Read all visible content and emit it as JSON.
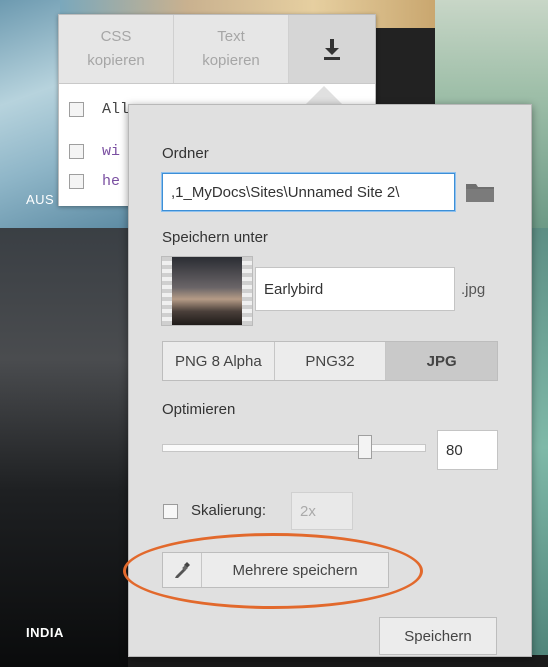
{
  "background": {
    "caption_top": "AUS",
    "caption_bottom": "INDIA"
  },
  "copy_popover": {
    "css_copy_label": "CSS kopieren",
    "css_copy_line1": "CSS",
    "css_copy_line2": "kopieren",
    "text_copy_line1": "Text",
    "text_copy_line2": "kopieren",
    "download_icon": "download-icon",
    "rows": [
      {
        "text": "All"
      },
      {
        "text": "wi"
      },
      {
        "text": "he"
      }
    ]
  },
  "dialog": {
    "folder_label": "Ordner",
    "folder_value": ",1_MyDocs\\Sites\\Unnamed Site 2\\",
    "folder_icon": "folder-icon",
    "save_as_label": "Speichern unter",
    "filename_value": "Earlybird",
    "extension": ".jpg",
    "formats": [
      {
        "label": "PNG 8 Alpha",
        "active": false
      },
      {
        "label": "PNG32",
        "active": false
      },
      {
        "label": "JPG",
        "active": true
      }
    ],
    "optimize_label": "Optimieren",
    "quality_value": "80",
    "quality_fraction": 0.8,
    "scaling_label": "Skalierung:",
    "scaling_checked": false,
    "scaling_placeholder": "2x",
    "multi_save_label": "Mehrere speichern",
    "save_label": "Speichern"
  },
  "colors": {
    "highlight_oval": "#e2692c",
    "focus_border": "#3d8fd6"
  }
}
